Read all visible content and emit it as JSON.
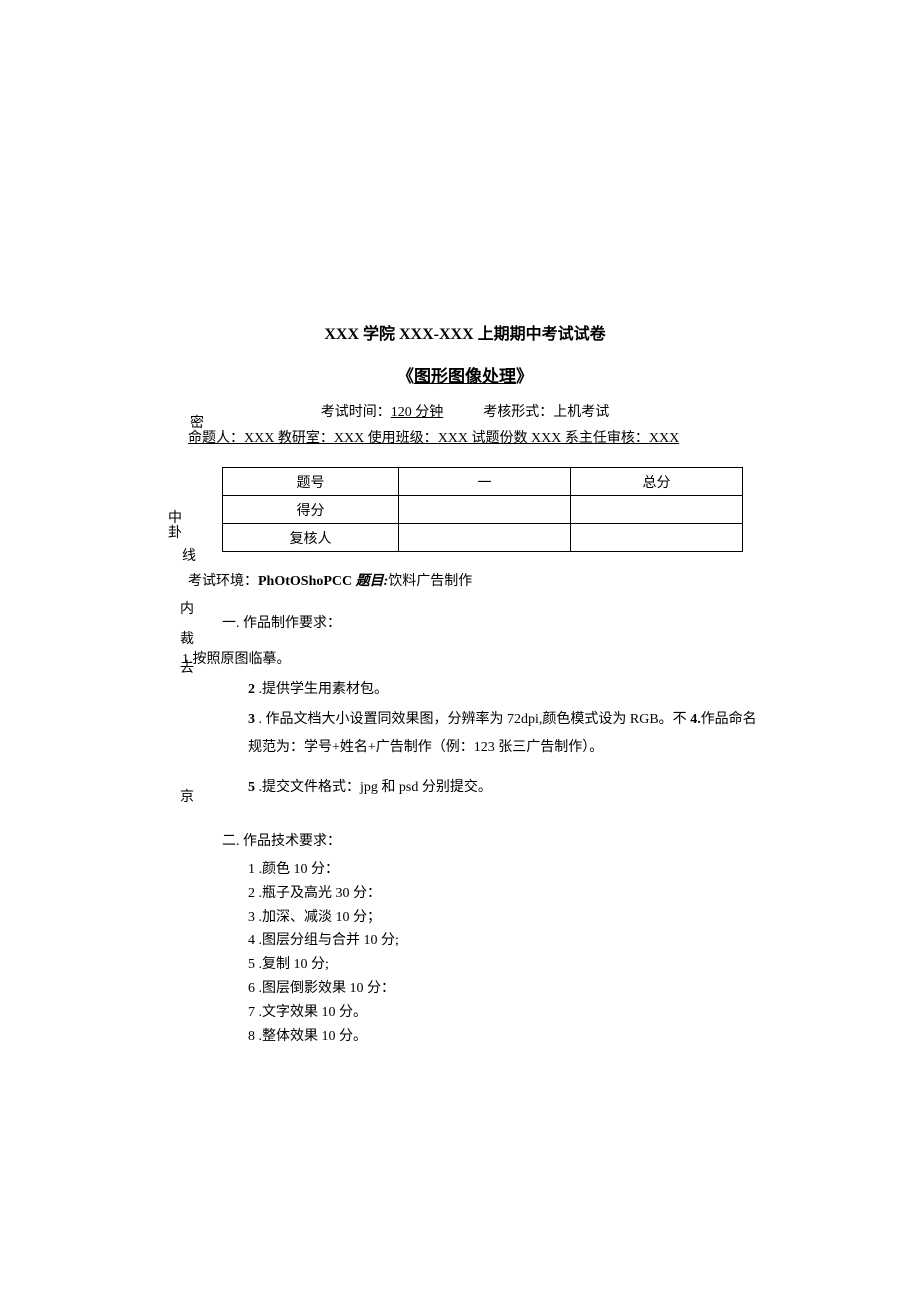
{
  "title": {
    "main": "XXX 学院 XXX-XXX 上期期中考试试卷",
    "sub_prefix": "《",
    "sub_text": "图形图像处理",
    "sub_suffix": "》"
  },
  "meta": {
    "exam_time_label": "考试时间：",
    "exam_time_value": "120 分钟",
    "exam_form_label": "考核形式：",
    "exam_form_value": "上机考试",
    "author_label": "命题人：",
    "author_value": "XXX",
    "dept_label": " 教研室：",
    "dept_value": "XXX",
    "class_label": " 使用班级：",
    "class_value": "XXX",
    "count_label": " 试题份数 ",
    "count_value": "XXX",
    "review_label": " 系主任审核：",
    "review_value": "XXX"
  },
  "table": {
    "r1c1": "题号",
    "r1c2": "一",
    "r1c3": "总分",
    "r2c1": "得分",
    "r3c1": "复核人"
  },
  "env": {
    "prefix": "考试环境：",
    "software": "PhOtOShoPCC",
    "topic_label": " 题目:",
    "topic_value": "饮料广告制作"
  },
  "margin": {
    "mi": "密",
    "zhong": "中",
    "fu": "卦",
    "xian": "线",
    "nei": "内",
    "cai": "裁",
    "qu": "去",
    "jing": "京"
  },
  "section1": {
    "heading": "一. 作品制作要求：",
    "item1_full": "1.按照原图临摹。",
    "item2_num": "2",
    "item2_text": " .提供学生用素材包。",
    "item3_num": "3",
    "item3_text": " . 作品文档大小设置同效果图，分辨率为 72dpi,颜色模式设为 RGB。不 ",
    "item4_label": "4.",
    "item4_text": "作品命名规范为：学号+姓名+广告制作（例：123 张三广告制作）。",
    "item5_num": "5",
    "item5_text": " .提交文件格式：jpg 和 psd 分别提交。"
  },
  "section2": {
    "heading": "二. 作品技术要求：",
    "items": [
      "1 .颜色 10 分：",
      "2 .瓶子及高光 30 分：",
      "3 .加深、减淡 10 分；",
      "4 .图层分组与合并 10 分;",
      "5 .复制 10 分;",
      "6 .图层倒影效果 10 分：",
      "7 .文字效果 10 分。",
      "8 .整体效果 10 分。"
    ]
  }
}
